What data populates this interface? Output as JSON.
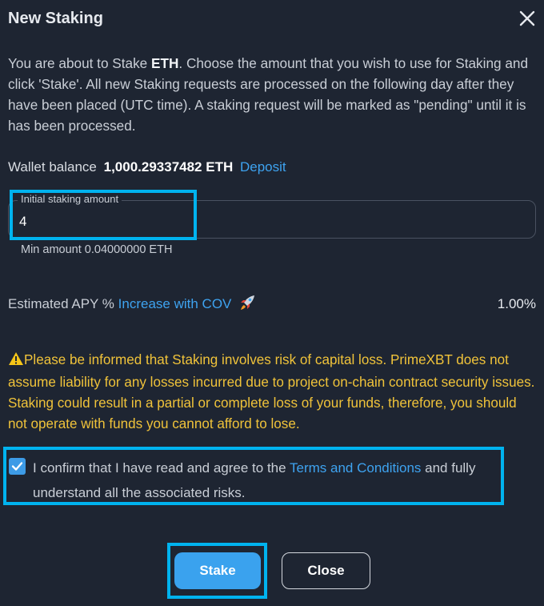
{
  "dialog": {
    "title": "New Staking",
    "close_icon": "close-icon"
  },
  "intro": {
    "part1": "You are about to Stake ",
    "asset": "ETH",
    "part2": ". Choose the amount that you wish to use for Staking and click 'Stake'. All new Staking requests are processed on the following day after they have been placed (UTC time). A staking request will be marked as \"pending\" until it is has been processed."
  },
  "wallet": {
    "label": "Wallet balance",
    "value": "1,000.29337482 ETH",
    "deposit_link": "Deposit"
  },
  "amount": {
    "label": "Initial staking amount",
    "value": "4",
    "min_text": "Min amount 0.04000000 ETH"
  },
  "apy": {
    "label": "Estimated APY % ",
    "link": "Increase with COV",
    "icon": "rocket-icon",
    "value": "1.00%"
  },
  "warning": {
    "icon": "warning-icon",
    "text": "Please be informed that Staking involves risk of capital loss. PrimeXBT does not assume liability for any losses incurred due to project on-chain contract security issues. Staking could result in a partial or complete loss of your funds, therefore, you should not operate with funds you cannot afford to lose."
  },
  "confirm": {
    "checked": true,
    "part1": "I confirm that I have read and agree to the ",
    "terms_link": "Terms and Conditions",
    "part2": " and fully understand all the associated risks."
  },
  "buttons": {
    "stake": "Stake",
    "close": "Close"
  },
  "colors": {
    "background": "#1e2532",
    "accent": "#3aa2ee",
    "link": "#3ea3f0",
    "warning": "#f0c33a",
    "highlight": "#00b3ef"
  }
}
